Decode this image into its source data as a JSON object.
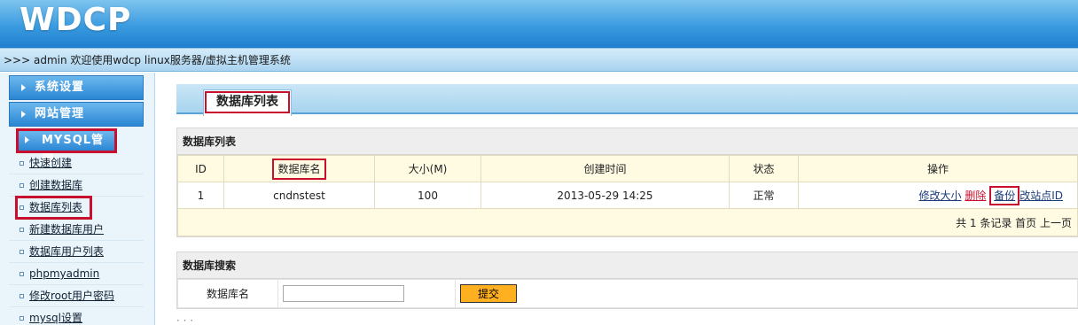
{
  "header": {
    "logo": "WDCP"
  },
  "welcome": {
    "text": ">>> admin 欢迎使用wdcp linux服务器/虚拟主机管理系统"
  },
  "sidebar": {
    "buttons": [
      {
        "label": "系统设置"
      },
      {
        "label": "网站管理"
      },
      {
        "label": "MYSQL管理"
      }
    ],
    "items": [
      {
        "label": "快速创建"
      },
      {
        "label": "创建数据库"
      },
      {
        "label": "数据库列表"
      },
      {
        "label": "新建数据库用户"
      },
      {
        "label": "数据库用户列表"
      },
      {
        "label": "phpmyadmin"
      },
      {
        "label": "修改root用户密码"
      },
      {
        "label": "mysql设置"
      }
    ]
  },
  "main": {
    "page_title": "数据库列表",
    "list_panel": {
      "title": "数据库列表",
      "columns": [
        "ID",
        "数据库名",
        "大小(M)",
        "创建时间",
        "状态",
        "操作"
      ],
      "rows": [
        {
          "id": "1",
          "name": "cndnstest",
          "size": "100",
          "created": "2013-05-29 14:25",
          "status": "正常"
        }
      ],
      "actions": {
        "resize": "修改大小",
        "delete": "删除",
        "backup": "备份",
        "change_site": "改站点ID"
      },
      "footer": "共 1 条记录  首页  上一页"
    },
    "search_panel": {
      "title": "数据库搜索",
      "label": "数据库名",
      "input_value": "",
      "submit": "提交"
    },
    "bottom_partial": "·  ·  ·"
  },
  "colors": {
    "accent": "#2a86d4",
    "highlight": "#c8102e",
    "submit": "#ffb020"
  }
}
